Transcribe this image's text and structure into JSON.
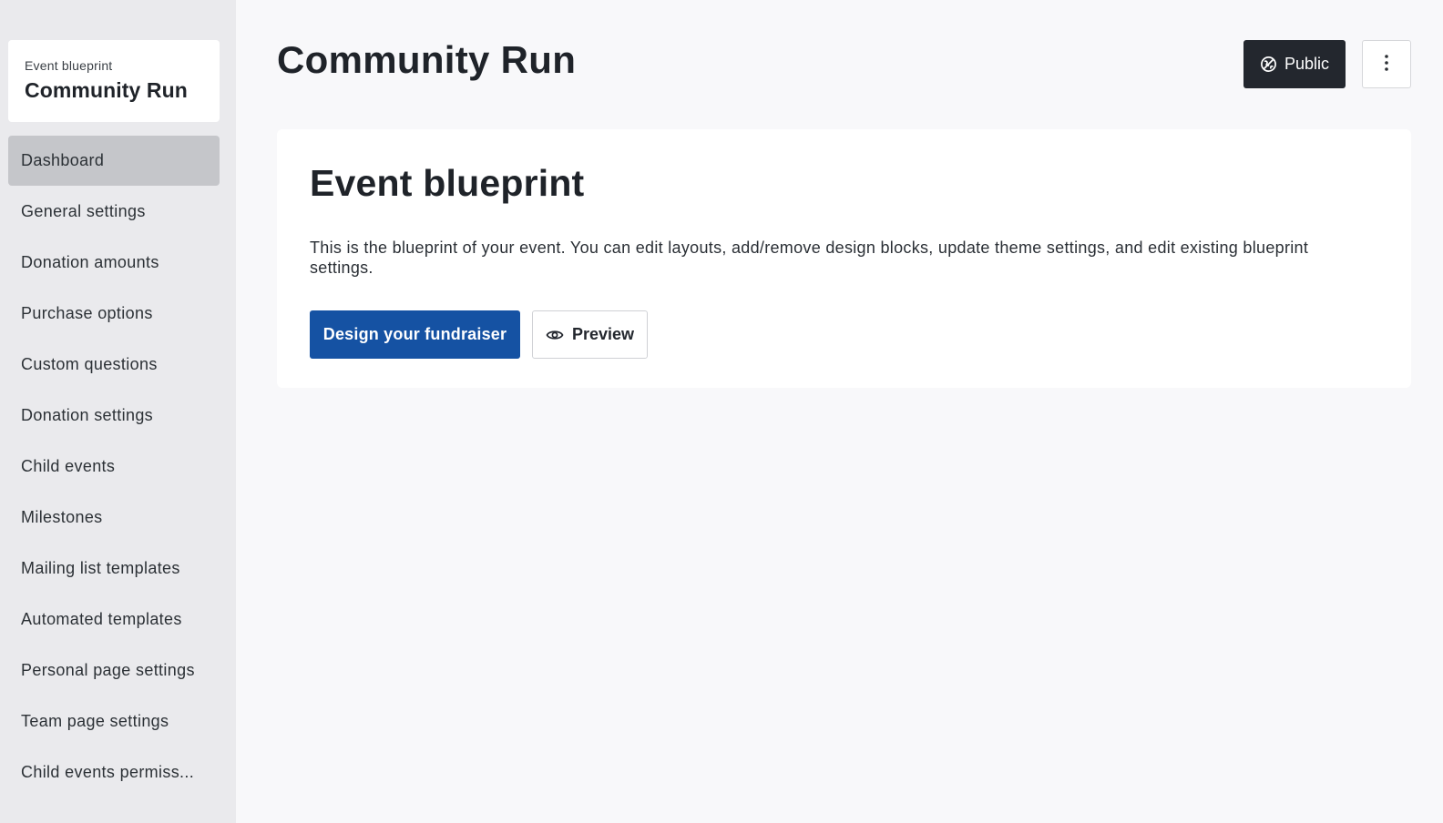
{
  "sidebar": {
    "event_card": {
      "eyebrow": "Event blueprint",
      "name": "Community Run"
    },
    "items": [
      {
        "label": "Dashboard",
        "active": true
      },
      {
        "label": "General settings"
      },
      {
        "label": "Donation amounts"
      },
      {
        "label": "Purchase options"
      },
      {
        "label": "Custom questions"
      },
      {
        "label": "Donation settings"
      },
      {
        "label": "Child events"
      },
      {
        "label": "Milestones"
      },
      {
        "label": "Mailing list templates"
      },
      {
        "label": "Automated templates"
      },
      {
        "label": "Personal page settings"
      },
      {
        "label": "Team page settings"
      },
      {
        "label": "Child events permiss..."
      }
    ]
  },
  "header": {
    "title": "Community Run",
    "public_label": "Public",
    "public_icon": "globe-slash-icon",
    "more_icon": "vertical-ellipsis-icon"
  },
  "card": {
    "title": "Event blueprint",
    "description": "This is the blueprint of your event. You can edit layouts, add/remove design blocks, update theme settings, and edit existing blueprint settings.",
    "design_label": "Design your fundraiser",
    "preview_label": "Preview",
    "preview_icon": "eye-icon"
  },
  "colors": {
    "sidebar_bg": "#eaeaed",
    "active_item_bg": "#c5c6ca",
    "primary_button": "#1552a3",
    "dark_button": "#23272e",
    "page_bg": "#f8f8fa"
  }
}
